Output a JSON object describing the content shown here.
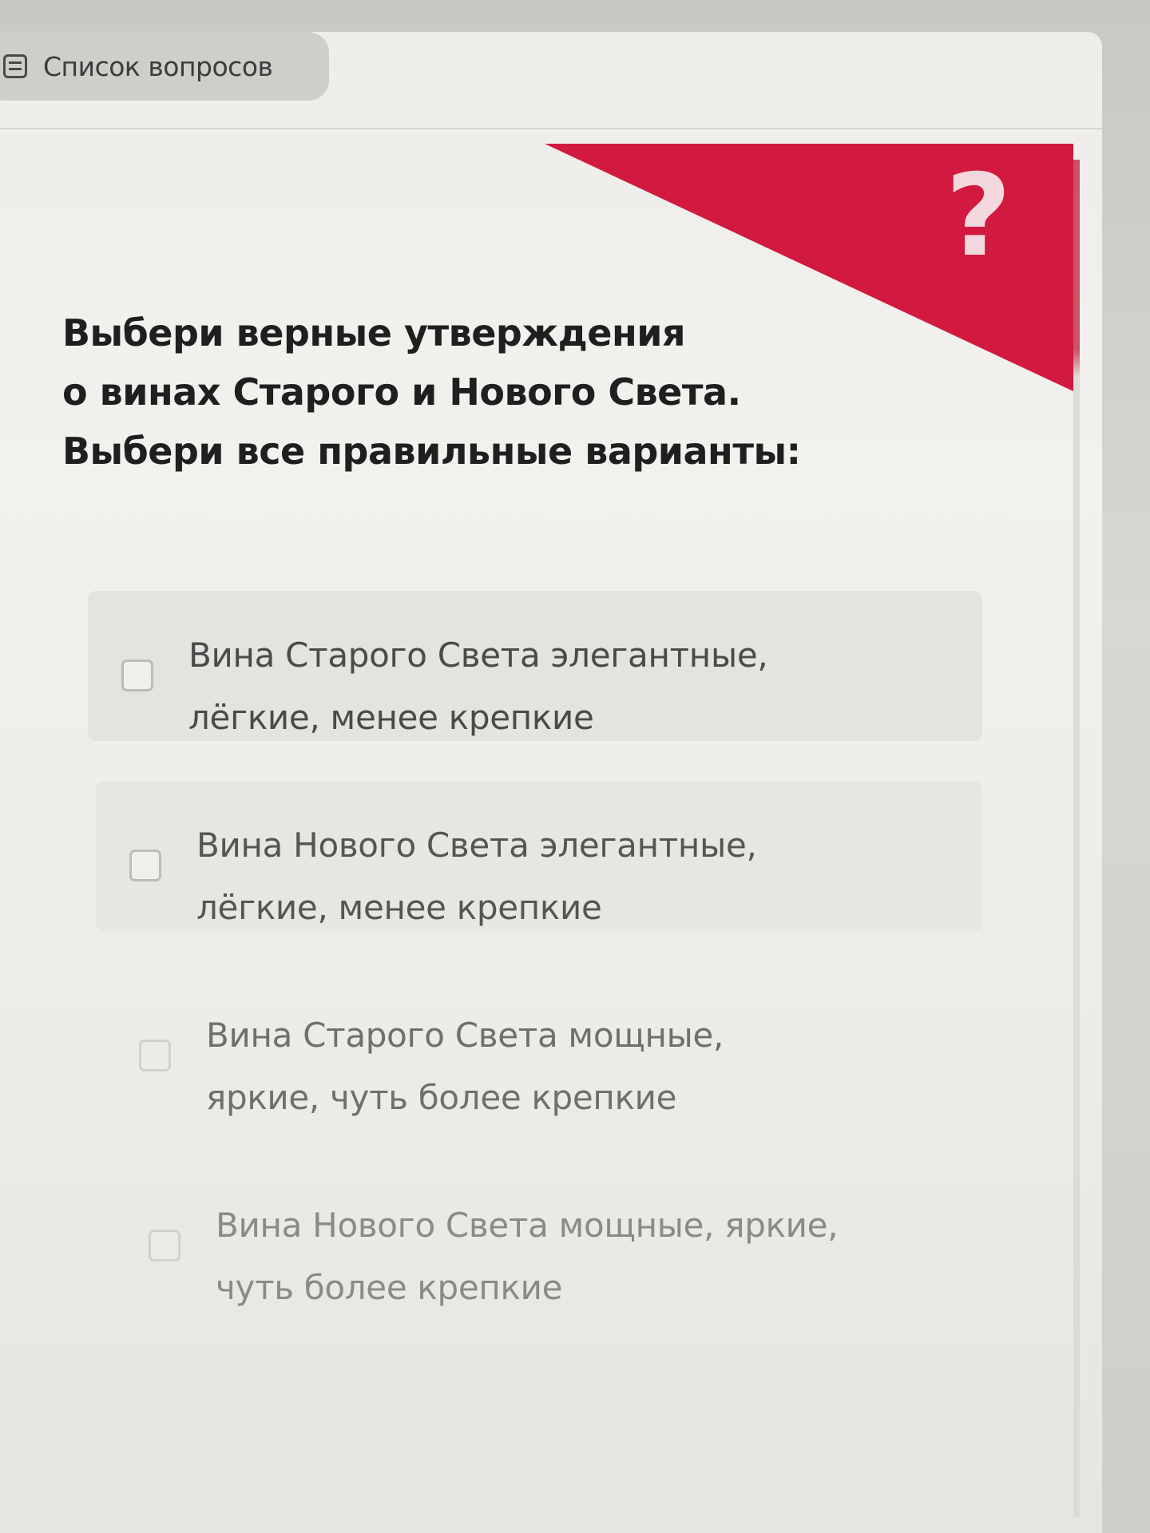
{
  "toolbar": {
    "questions_list_label": "Список вопросов"
  },
  "question": {
    "mark": "?",
    "lines": [
      "Выбери верные утверждения",
      "о винах Старого и Нового Света.",
      "Выбери все правильные варианты:"
    ]
  },
  "options": [
    {
      "label": "Вина Старого Света элегантные,\nлёгкие, менее крепкие",
      "checked": false
    },
    {
      "label": "Вина Нового Света элегантные,\nлёгкие, менее крепкие",
      "checked": false
    },
    {
      "label": "Вина Старого Света мощные,\nяркие, чуть более крепкие",
      "checked": false
    },
    {
      "label": "Вина Нового Света мощные, яркие,\nчуть более крепкие",
      "checked": false
    }
  ],
  "colors": {
    "accent": "#d2193f"
  }
}
